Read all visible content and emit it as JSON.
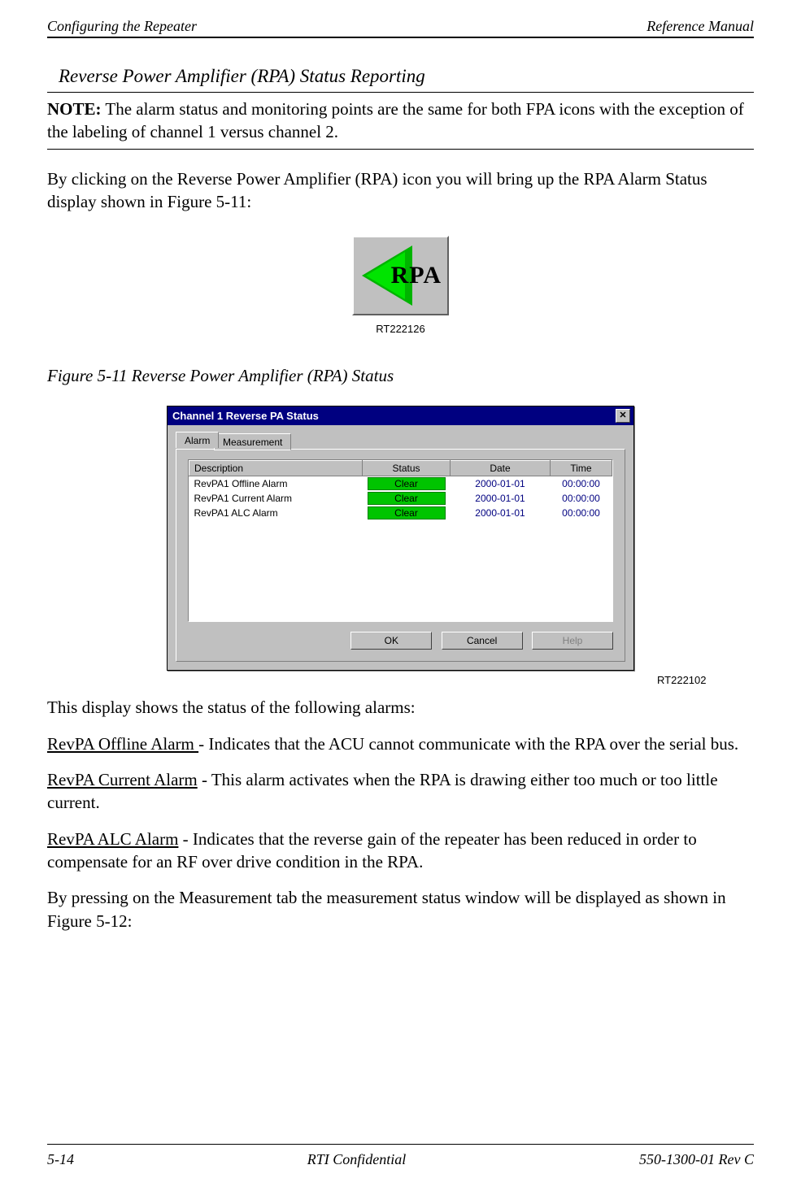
{
  "header": {
    "left": "Configuring the Repeater",
    "right": "Reference Manual"
  },
  "section_title": "Reverse Power Amplifier (RPA) Status Reporting",
  "note": {
    "label": "NOTE:",
    "text": "  The alarm status and monitoring points are the same for both FPA icons with the exception of the labeling of channel 1 versus channel 2."
  },
  "intro_p": "By clicking on the Reverse Power Amplifier (RPA) icon you will bring up the RPA Alarm Status display shown in Figure 5-11:",
  "rpa_icon": {
    "label": "RPA",
    "caption": "RT222126"
  },
  "figure_caption": "Figure 5-11      Reverse Power Amplifier (RPA) Status",
  "dialog": {
    "title": "Channel 1 Reverse PA Status",
    "tabs": {
      "active": "Alarm",
      "inactive": "Measurement"
    },
    "columns": {
      "desc": "Description",
      "status": "Status",
      "date": "Date",
      "time": "Time"
    },
    "rows": [
      {
        "desc": "RevPA1 Offline Alarm",
        "status": "Clear",
        "date": "2000-01-01",
        "time": "00:00:00"
      },
      {
        "desc": "RevPA1 Current Alarm",
        "status": "Clear",
        "date": "2000-01-01",
        "time": "00:00:00"
      },
      {
        "desc": "RevPA1 ALC Alarm",
        "status": "Clear",
        "date": "2000-01-01",
        "time": "00:00:00"
      }
    ],
    "buttons": {
      "ok": "OK",
      "cancel": "Cancel",
      "help": "Help"
    },
    "rt": "RT222102"
  },
  "post_p1": "This display shows the status of the following alarms:",
  "alarm1": {
    "name": "RevPA Offline Alarm ",
    "desc": "- Indicates that the ACU cannot communicate with the RPA over the serial bus."
  },
  "alarm2": {
    "name": "RevPA Current Alarm",
    "desc": " - This alarm activates when the RPA is drawing either too much or too little current."
  },
  "alarm3": {
    "name": "RevPA ALC Alarm",
    "desc": " - Indicates that the reverse gain of the repeater has been reduced in order to compensate for an RF over drive condition in the RPA."
  },
  "post_p2": "By pressing on the Measurement tab the measurement status window will be displayed as shown in Figure 5-12:",
  "footer": {
    "left": "5-14",
    "center": "RTI Confidential",
    "right": "550-1300-01 Rev C"
  }
}
